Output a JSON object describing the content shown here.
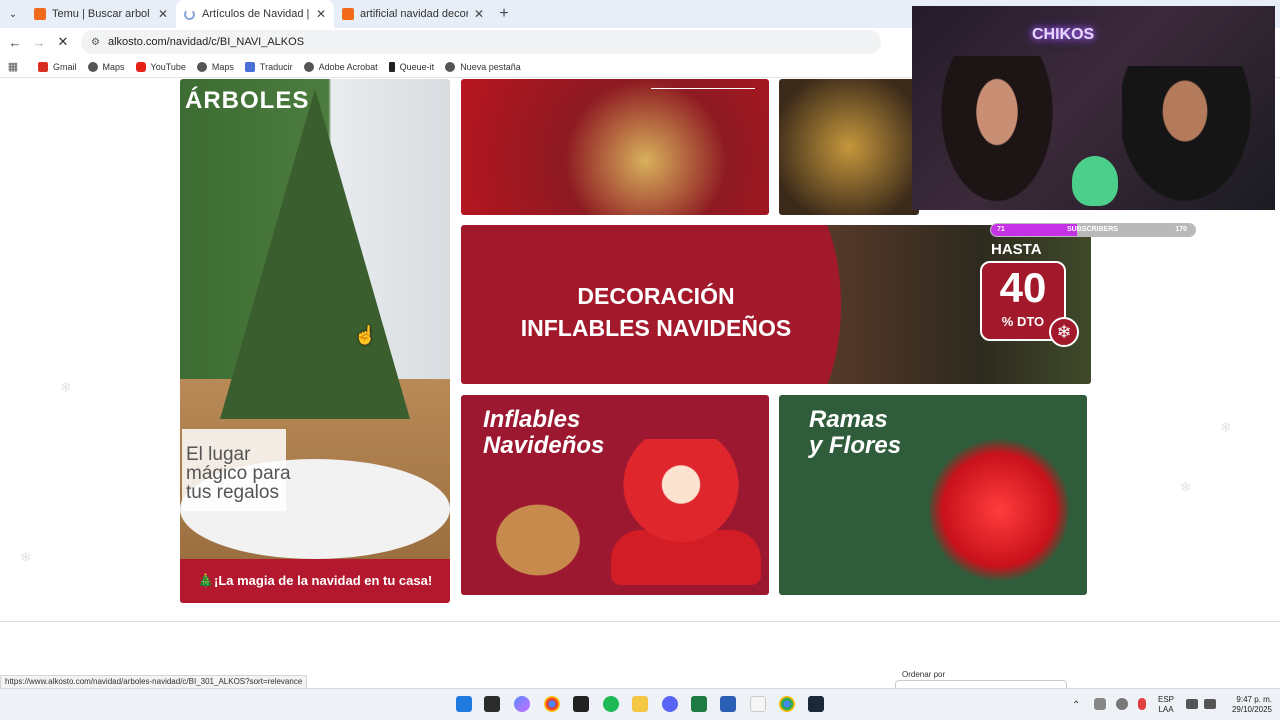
{
  "browser": {
    "tabs": [
      {
        "label": "Temu | Buscar arbol de navidad",
        "favicon_color": "#f26b1d",
        "active": false,
        "loading": false
      },
      {
        "label": "Artículos de Navidad | Alkosto",
        "favicon_color": "#8aa6d8",
        "active": true,
        "loading": true
      },
      {
        "label": "artificial navidad decoración re",
        "favicon_color": "#f26b1d",
        "active": false,
        "loading": false
      }
    ],
    "close_glyph": "✕",
    "new_tab_glyph": "+",
    "menu_glyph": "⌄",
    "url": "alkosto.com/navidad/c/BI_NAVI_ALKOS",
    "back_glyph": "←",
    "forward_glyph": "→",
    "stop_glyph": "✕",
    "site_info_glyph": "⚙",
    "apps_glyph": "▦",
    "bookmarks": [
      {
        "label": "Gmail",
        "icon": "gmail-icon",
        "color": "#d93025"
      },
      {
        "label": "Maps",
        "icon": "globe-icon",
        "color": "#555555"
      },
      {
        "label": "YouTube",
        "icon": "youtube-icon",
        "color": "#e62117"
      },
      {
        "label": "Maps",
        "icon": "maps-icon",
        "color": "#555555"
      },
      {
        "label": "Traducir",
        "icon": "translate-icon",
        "color": "#4a6fd6"
      },
      {
        "label": "Adobe Acrobat",
        "icon": "globe-icon",
        "color": "#555555"
      },
      {
        "label": "Queue-it",
        "icon": "queueit-icon",
        "color": "#222222"
      },
      {
        "label": "Nueva pestaña",
        "icon": "globe-icon",
        "color": "#555555"
      }
    ]
  },
  "page": {
    "arboles": {
      "title": "ÁRBOLES",
      "tagline": "El lugar mágico para tus regalos",
      "footer": "🎄¡La magia de la navidad en tu casa!"
    },
    "banner": {
      "headline_line1": "DECORACIÓN",
      "headline_line2": "INFLABLES NAVIDEÑOS",
      "hasta": "HASTA",
      "discount": "40",
      "dto": "% DTO",
      "flake": "❄"
    },
    "inflables": {
      "line1": "Inflables",
      "line2": "Navideños"
    },
    "ramas": {
      "line1": "Ramas",
      "line2": "y Flores"
    },
    "sort_label": "Ordenar por"
  },
  "overlay": {
    "neon_text": "CHIKOS",
    "subscribers_current": "71",
    "subscribers_label": "SUBSCRIBERS",
    "subscribers_goal": "170",
    "subscribers_fraction": 0.42
  },
  "status_url": "https://www.alkosto.com/navidad/arboles-navidad/c/BI_301_ALKOS?sort=relevance",
  "taskbar": {
    "lang_line1": "ESP",
    "lang_line2": "LAA",
    "time": "9:47 p. m.",
    "date": "29/10/2025",
    "chevron": "⌃"
  },
  "colors": {
    "brand_red": "#a3192c",
    "tab_bar": "#e8eef7"
  }
}
